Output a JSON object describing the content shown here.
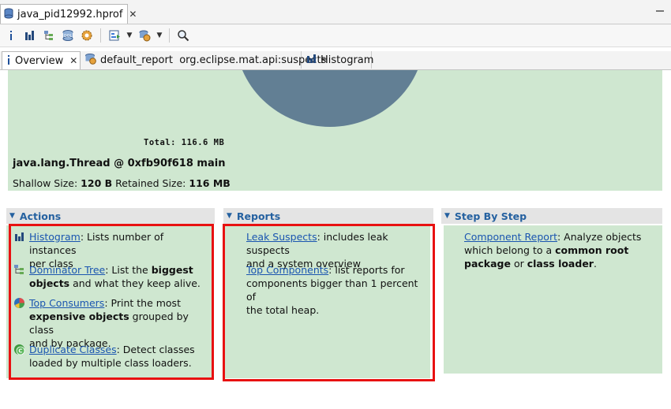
{
  "file_tab": {
    "label": "java_pid12992.hprof",
    "close": "✕"
  },
  "editor_tabs": [
    {
      "label": "Overview",
      "close": "✕"
    },
    {
      "label": "default_report  org.eclipse.mat.api:suspects"
    },
    {
      "label": "Histogram"
    }
  ],
  "overview": {
    "total": "Total: 116.6 MB",
    "object_name": "java.lang.Thread @ 0xfb90f618 main",
    "shallow_label": "Shallow Size:",
    "shallow_value": "120 B",
    "retained_label": "Retained Size:",
    "retained_value": "116 MB",
    "pie_color": "#627f94"
  },
  "actions": {
    "title": "Actions",
    "items": [
      {
        "link": "Histogram",
        "text1": ": Lists number of instances",
        "text2": "per class",
        "icon": "histogram-icon"
      },
      {
        "link": "Dominator Tree",
        "text1": ": List the ",
        "bold1": "biggest",
        "bold2": "objects",
        "text2": " and what they keep alive.",
        "icon": "dominator-tree-icon"
      },
      {
        "link": "Top Consumers",
        "text1": ": Print the most",
        "bold1": "expensive objects",
        "text2": " grouped by class",
        "text3": "and by package.",
        "icon": "top-consumers-icon"
      },
      {
        "link": "Duplicate Classes",
        "text1": ": Detect classes",
        "text2": "loaded by multiple class loaders.",
        "icon": "duplicate-classes-icon"
      }
    ]
  },
  "reports": {
    "title": "Reports",
    "items": [
      {
        "link": "Leak Suspects",
        "text1": ": includes leak suspects",
        "text2": "and a system overview"
      },
      {
        "link": "Top Components",
        "text1": ": list reports for",
        "text2": "components bigger than 1 percent of",
        "text3": "the total heap."
      }
    ]
  },
  "step_by_step": {
    "title": "Step By Step",
    "item": {
      "link": "Component Report",
      "text1": ": Analyze objects",
      "text2a": "which belong to a ",
      "bold1": "common root",
      "bold2": "package",
      "text3": " or ",
      "bold3": "class loader",
      "text4": "."
    }
  },
  "colors": {
    "panel_bg": "#cfe7d0",
    "link": "#1a55b0",
    "section_title": "#2561a0",
    "highlight_box": "#e81111"
  }
}
